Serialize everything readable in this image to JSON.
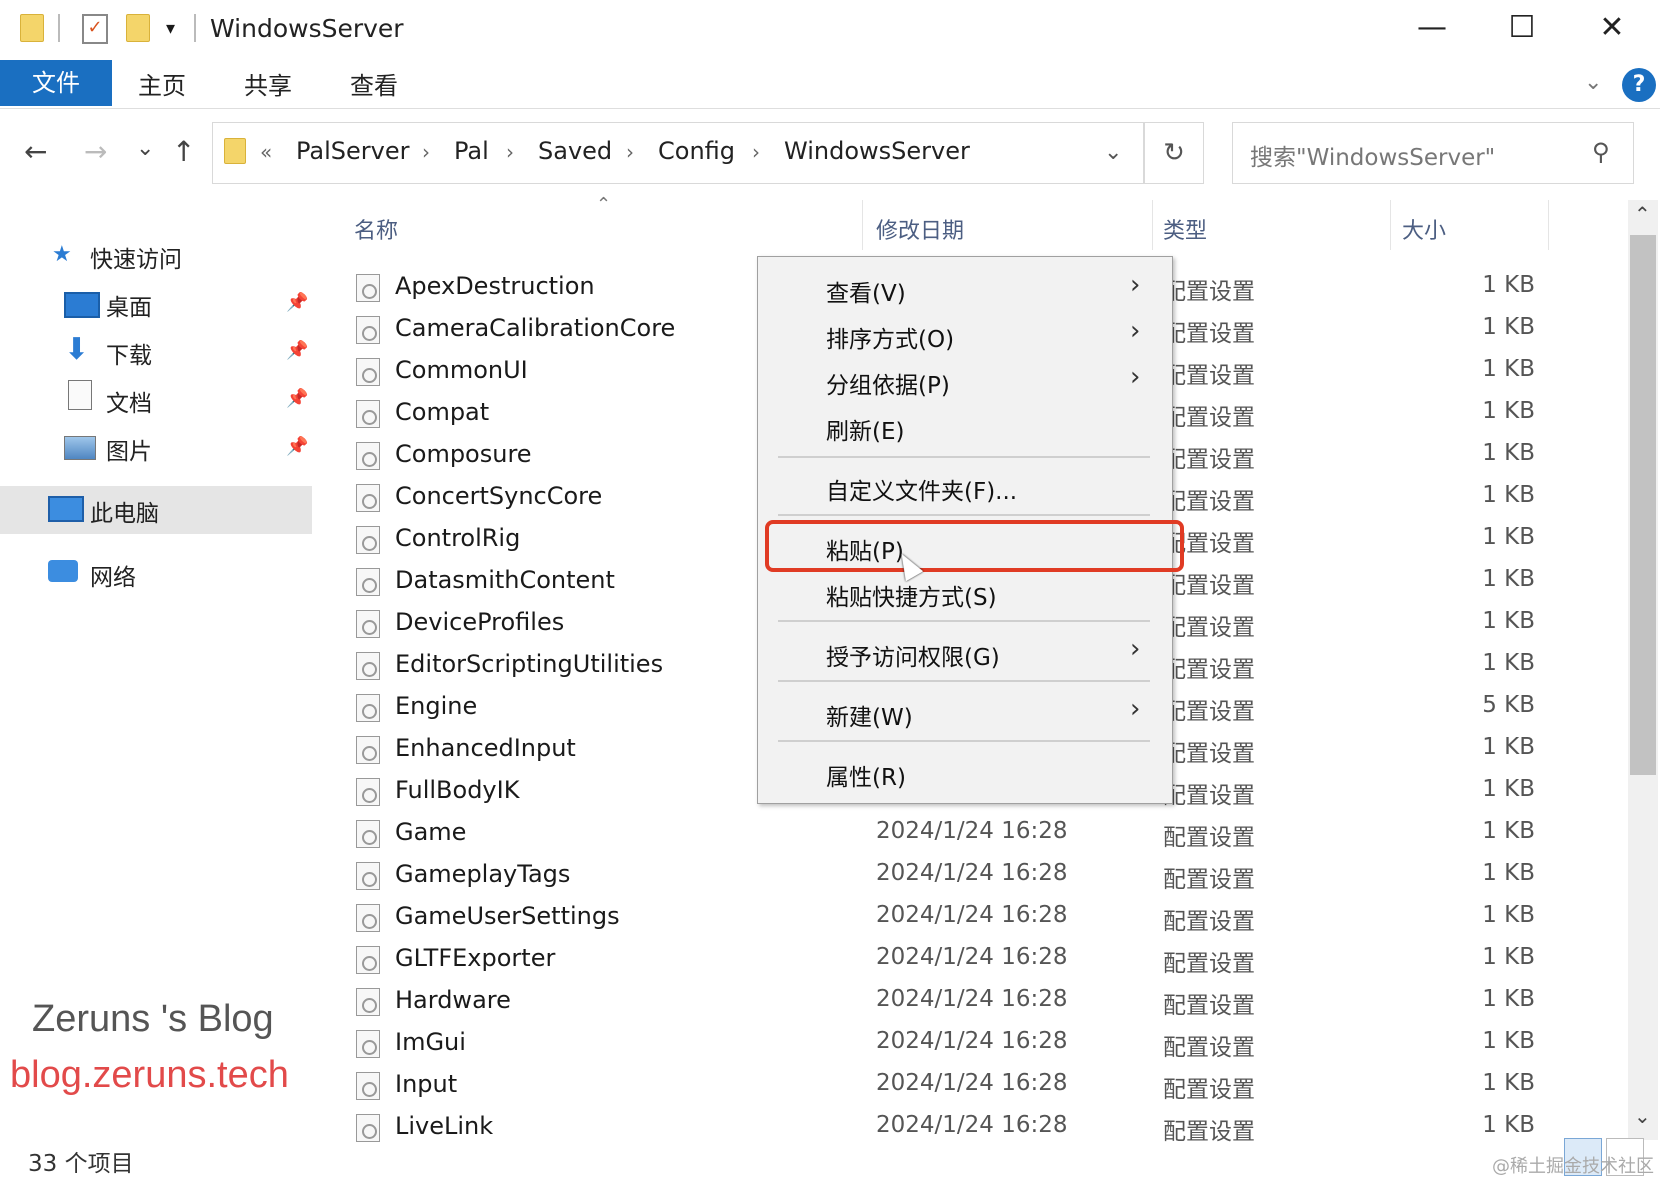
{
  "window": {
    "title": "WindowsServer",
    "controls": {
      "minimize": "—",
      "maximize": "☐",
      "close": "✕"
    }
  },
  "ribbon": {
    "file_tab": "文件",
    "tabs": [
      "主页",
      "共享",
      "查看"
    ],
    "help": "?"
  },
  "nav": {
    "back": "←",
    "forward": "→",
    "recent": "⌄",
    "up": "↑",
    "breadcrumb_prefix": "«",
    "breadcrumb": [
      "PalServer",
      "Pal",
      "Saved",
      "Config",
      "WindowsServer"
    ],
    "refresh": "↻",
    "search_placeholder": "搜索\"WindowsServer\"",
    "search_icon": "search-icon"
  },
  "sidebar": {
    "quick_access": "快速访问",
    "items": [
      {
        "label": "桌面",
        "icon": "desktop-icon"
      },
      {
        "label": "下载",
        "icon": "download-icon"
      },
      {
        "label": "文档",
        "icon": "document-icon"
      },
      {
        "label": "图片",
        "icon": "picture-icon"
      }
    ],
    "this_pc": "此电脑",
    "network": "网络"
  },
  "list": {
    "columns": [
      "名称",
      "修改日期",
      "类型",
      "大小"
    ],
    "rows": [
      {
        "name": "ApexDestruction",
        "date": "",
        "type": "配置设置",
        "size": "1 KB"
      },
      {
        "name": "CameraCalibrationCore",
        "date": "",
        "type": "配置设置",
        "size": "1 KB"
      },
      {
        "name": "CommonUI",
        "date": "",
        "type": "配置设置",
        "size": "1 KB"
      },
      {
        "name": "Compat",
        "date": "",
        "type": "配置设置",
        "size": "1 KB"
      },
      {
        "name": "Composure",
        "date": "",
        "type": "配置设置",
        "size": "1 KB"
      },
      {
        "name": "ConcertSyncCore",
        "date": "",
        "type": "配置设置",
        "size": "1 KB"
      },
      {
        "name": "ControlRig",
        "date": "",
        "type": "配置设置",
        "size": "1 KB"
      },
      {
        "name": "DatasmithContent",
        "date": "",
        "type": "配置设置",
        "size": "1 KB"
      },
      {
        "name": "DeviceProfiles",
        "date": "",
        "type": "配置设置",
        "size": "1 KB"
      },
      {
        "name": "EditorScriptingUtilities",
        "date": "",
        "type": "配置设置",
        "size": "1 KB"
      },
      {
        "name": "Engine",
        "date": "",
        "type": "配置设置",
        "size": "5 KB"
      },
      {
        "name": "EnhancedInput",
        "date": "",
        "type": "配置设置",
        "size": "1 KB"
      },
      {
        "name": "FullBodyIK",
        "date": "",
        "type": "配置设置",
        "size": "1 KB"
      },
      {
        "name": "Game",
        "date": "2024/1/24 16:28",
        "type": "配置设置",
        "size": "1 KB"
      },
      {
        "name": "GameplayTags",
        "date": "2024/1/24 16:28",
        "type": "配置设置",
        "size": "1 KB"
      },
      {
        "name": "GameUserSettings",
        "date": "2024/1/24 16:28",
        "type": "配置设置",
        "size": "1 KB"
      },
      {
        "name": "GLTFExporter",
        "date": "2024/1/24 16:28",
        "type": "配置设置",
        "size": "1 KB"
      },
      {
        "name": "Hardware",
        "date": "2024/1/24 16:28",
        "type": "配置设置",
        "size": "1 KB"
      },
      {
        "name": "ImGui",
        "date": "2024/1/24 16:28",
        "type": "配置设置",
        "size": "1 KB"
      },
      {
        "name": "Input",
        "date": "2024/1/24 16:28",
        "type": "配置设置",
        "size": "1 KB"
      },
      {
        "name": "LiveLink",
        "date": "2024/1/24 16:28",
        "type": "配置设置",
        "size": "1 KB"
      }
    ]
  },
  "context_menu": {
    "items": [
      {
        "label": "查看(V)",
        "submenu": true
      },
      {
        "label": "排序方式(O)",
        "submenu": true
      },
      {
        "label": "分组依据(P)",
        "submenu": true
      },
      {
        "label": "刷新(E)",
        "submenu": false
      },
      {
        "label": "自定义文件夹(F)...",
        "submenu": false
      },
      {
        "label": "粘贴(P)",
        "submenu": false,
        "highlighted": true
      },
      {
        "label": "粘贴快捷方式(S)",
        "submenu": false
      },
      {
        "label": "授予访问权限(G)",
        "submenu": true
      },
      {
        "label": "新建(W)",
        "submenu": true
      },
      {
        "label": "属性(R)",
        "submenu": false
      }
    ],
    "highlight_color": "#e03b24"
  },
  "status": {
    "count": "33 个项目"
  },
  "watermark": {
    "line1": "Zeruns 's Blog",
    "line2": "blog.zeruns.tech",
    "line3": "@稀土掘金技术社区"
  },
  "colors": {
    "accent": "#1a6fc1",
    "highlight": "#e03b24"
  }
}
